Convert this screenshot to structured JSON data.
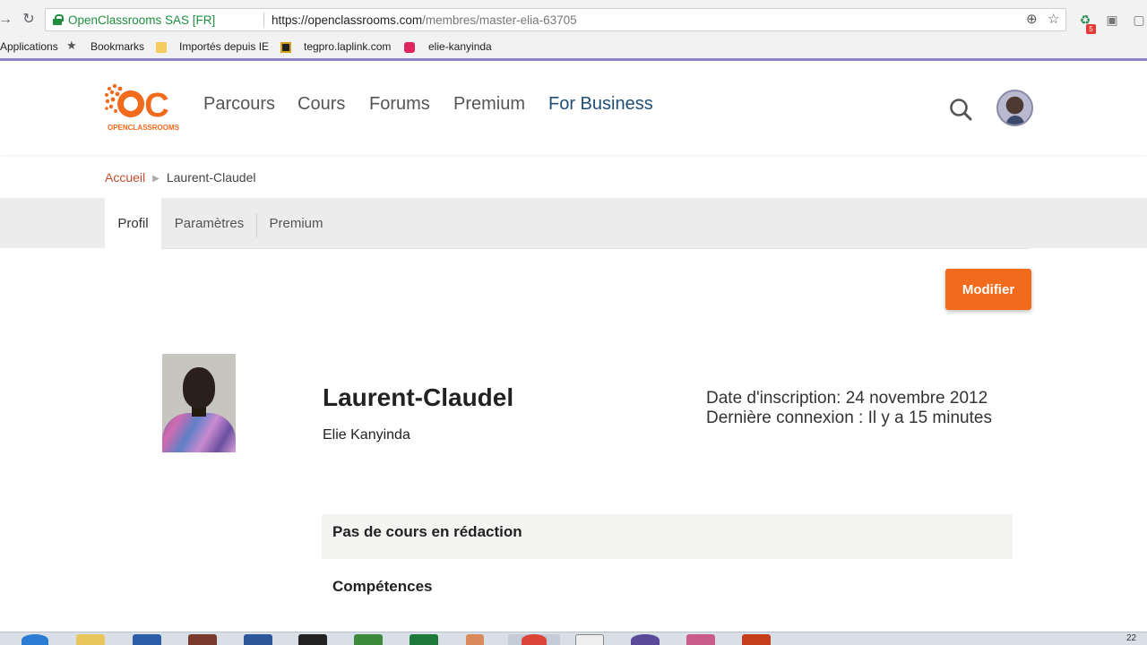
{
  "browser": {
    "site_identity": "OpenClassrooms SAS [FR]",
    "url_host": "https://openclassrooms.com",
    "url_path": "/membres/master-elia-63705",
    "extension_badge": "5",
    "bookmarks": [
      {
        "label": "Applications"
      },
      {
        "label": "Bookmarks"
      },
      {
        "label": "Importés depuis IE"
      },
      {
        "label": "tegpro.laplink.com"
      },
      {
        "label": "elie-kanyinda"
      }
    ]
  },
  "header": {
    "logo_text": "OPENCLASSROOMS",
    "logo_glyph": "C",
    "brand_color": "#f26a1b",
    "nav": [
      {
        "label": "Parcours"
      },
      {
        "label": "Cours"
      },
      {
        "label": "Forums"
      },
      {
        "label": "Premium"
      },
      {
        "label": "For Business"
      }
    ]
  },
  "breadcrumb": {
    "home": "Accueil",
    "current": "Laurent-Claudel"
  },
  "tabs": [
    {
      "label": "Profil",
      "active": true
    },
    {
      "label": "Paramètres",
      "active": false
    },
    {
      "label": "Premium",
      "active": false
    }
  ],
  "profile": {
    "edit_label": "Modifier",
    "username": "Laurent-Claudel",
    "full_name": "Elie Kanyinda",
    "signup": "Date d'inscription: 24 novembre 2012",
    "last_login": "Dernière connexion : Il y a 15 minutes",
    "courses_status": "Pas de cours en rédaction",
    "skills_heading": "Compétences"
  },
  "taskbar": {
    "clock": "22"
  }
}
